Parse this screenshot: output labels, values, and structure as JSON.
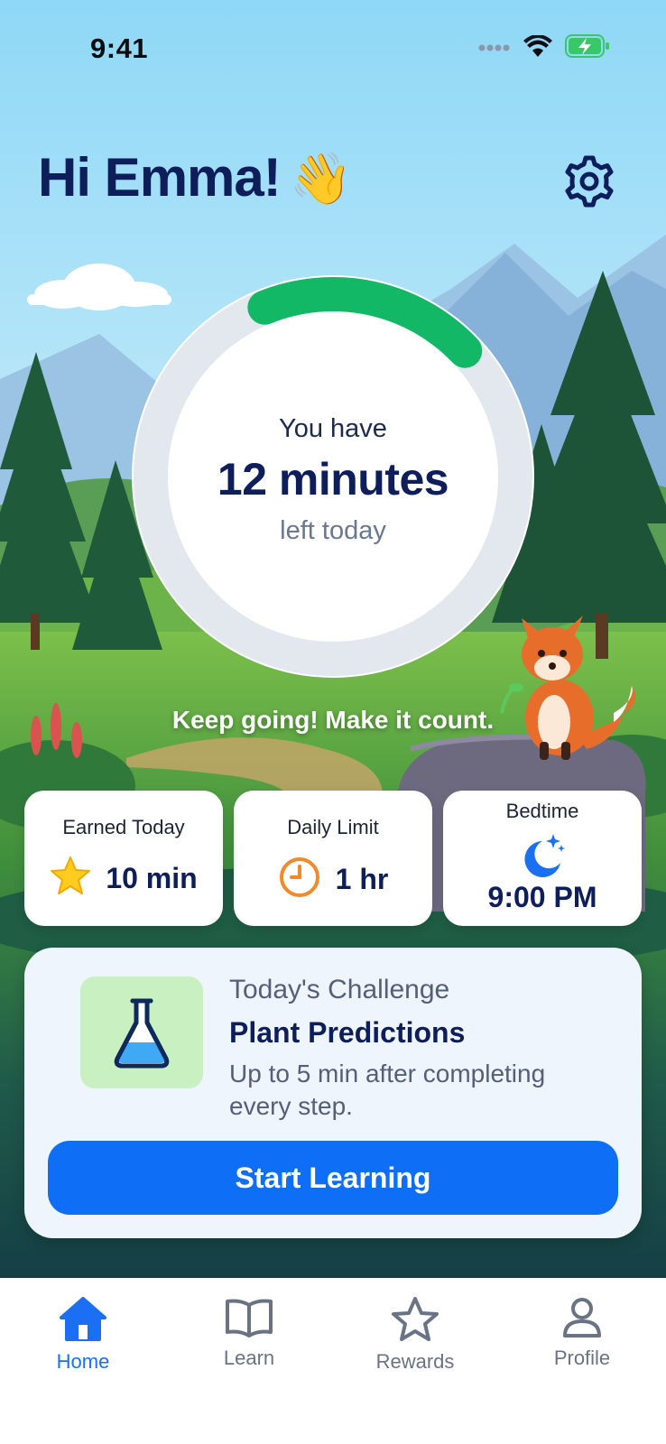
{
  "status_bar": {
    "time": "9:41",
    "icons": [
      "signal-dots-icon",
      "wifi-icon",
      "battery-charging-icon"
    ]
  },
  "header": {
    "greeting": "Hi Emma!",
    "wave_emoji": "👋",
    "settings_icon": "gear-icon"
  },
  "timer": {
    "prefix": "You have",
    "remaining": "12 minutes",
    "suffix": "left today",
    "progress_fraction": 0.19,
    "progress_color": "#12b866",
    "track_color": "#e3e8ef"
  },
  "encouragement": "Keep going! Make it count.",
  "stats": [
    {
      "label": "Earned Today",
      "value": "10 min",
      "icon": "star-icon"
    },
    {
      "label": "Daily Limit",
      "value": "1 hr",
      "icon": "clock-icon"
    },
    {
      "label": "Bedtime",
      "value": "9:00 PM",
      "icon": "moon-stars-icon"
    }
  ],
  "challenge": {
    "kicker": "Today's Challenge",
    "title": "Plant Predictions",
    "description": "Up to 5 min after completing every step.",
    "icon": "flask-icon",
    "button_label": "Start Learning"
  },
  "tabs": [
    {
      "label": "Home",
      "icon": "home-icon",
      "active": true
    },
    {
      "label": "Learn",
      "icon": "book-icon",
      "active": false
    },
    {
      "label": "Rewards",
      "icon": "star-outline-icon",
      "active": false
    },
    {
      "label": "Profile",
      "icon": "person-icon",
      "active": false
    }
  ],
  "colors": {
    "accent": "#0f6ef6",
    "heading": "#0e1e5b",
    "active_tab": "#1a6ff2"
  }
}
